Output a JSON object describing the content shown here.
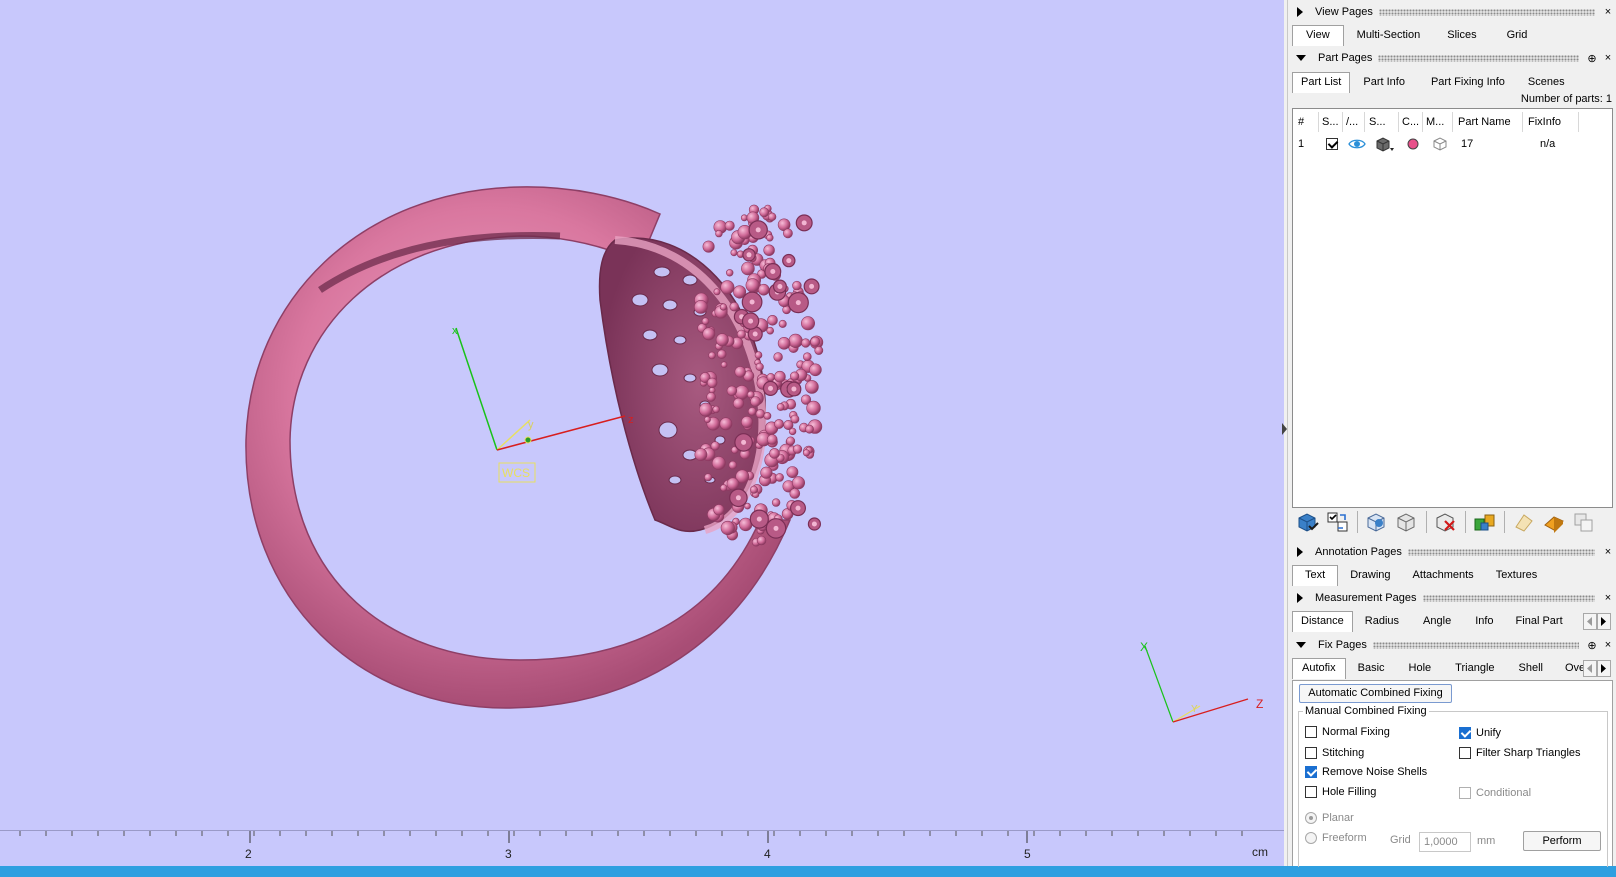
{
  "viewport": {
    "background": "#c8c8fc",
    "model_color": "#d97aa5",
    "wcs_label": "WCS",
    "axis_x": "x",
    "axis_y": "y",
    "axis_z": "z",
    "corner_axis_x": "X",
    "corner_axis_y": "Y",
    "corner_axis_z": "Z",
    "ruler": {
      "ticks": [
        "2",
        "3",
        "4",
        "5"
      ],
      "unit": "cm"
    }
  },
  "view_pages": {
    "title": "View Pages",
    "close": "×",
    "tabs": [
      "View",
      "Multi-Section",
      "Slices",
      "Grid"
    ],
    "active_tab": "View"
  },
  "part_pages": {
    "title": "Part Pages",
    "pin": "⊕",
    "close": "×",
    "tabs": [
      "Part List",
      "Part Info",
      "Part Fixing Info",
      "Scenes"
    ],
    "active_tab": "Part List",
    "num_parts_label": "Number of parts: 1",
    "columns": [
      "#",
      "S...",
      "/...",
      "S...",
      "C...",
      "M...",
      "Part Name",
      "FixInfo"
    ],
    "rows": [
      {
        "index": "1",
        "selected": true,
        "visible_icon": "eye-icon",
        "shade_icon": "solid-shade-icon",
        "color": "#e8508a",
        "mesh_icon": "mesh-box-icon",
        "part_name": "17",
        "fix_info": "n/a"
      }
    ],
    "toolbar": [
      "add-part-icon",
      "select-parts-icon",
      "separator",
      "show-all-icon",
      "hide-all-icon",
      "separator",
      "remove-part-icon",
      "separator",
      "merge-parts-icon",
      "separator",
      "move-part-icon",
      "orange-part-icon",
      "duplicate-part-icon"
    ]
  },
  "annotation_pages": {
    "title": "Annotation Pages",
    "close": "×",
    "tabs": [
      "Text",
      "Drawing",
      "Attachments",
      "Textures"
    ],
    "active_tab": "Text"
  },
  "measurement_pages": {
    "title": "Measurement Pages",
    "close": "×",
    "tabs": [
      "Distance",
      "Radius",
      "Angle",
      "Info",
      "Final Part"
    ],
    "active_tab": "Distance"
  },
  "fix_pages": {
    "title": "Fix Pages",
    "pin": "⊕",
    "close": "×",
    "tabs": [
      "Autofix",
      "Basic",
      "Hole",
      "Triangle",
      "Shell",
      "Over"
    ],
    "active_tab": "Autofix",
    "auto_button": "Automatic Combined Fixing",
    "manual_group": "Manual Combined Fixing",
    "options": {
      "normal_fixing": {
        "label": "Normal Fixing",
        "checked": false
      },
      "unify": {
        "label": "Unify",
        "checked": true
      },
      "stitching": {
        "label": "Stitching",
        "checked": false
      },
      "filter_sharp": {
        "label": "Filter Sharp Triangles",
        "checked": false
      },
      "remove_noise": {
        "label": "Remove Noise Shells",
        "checked": true
      },
      "hole_filling": {
        "label": "Hole Filling",
        "checked": false
      },
      "conditional": {
        "label": "Conditional",
        "checked": false
      }
    },
    "planar": "Planar",
    "freeform": "Freeform",
    "grid_label": "Grid",
    "grid_value": "1,0000",
    "grid_unit": "mm",
    "perform": "Perform"
  }
}
